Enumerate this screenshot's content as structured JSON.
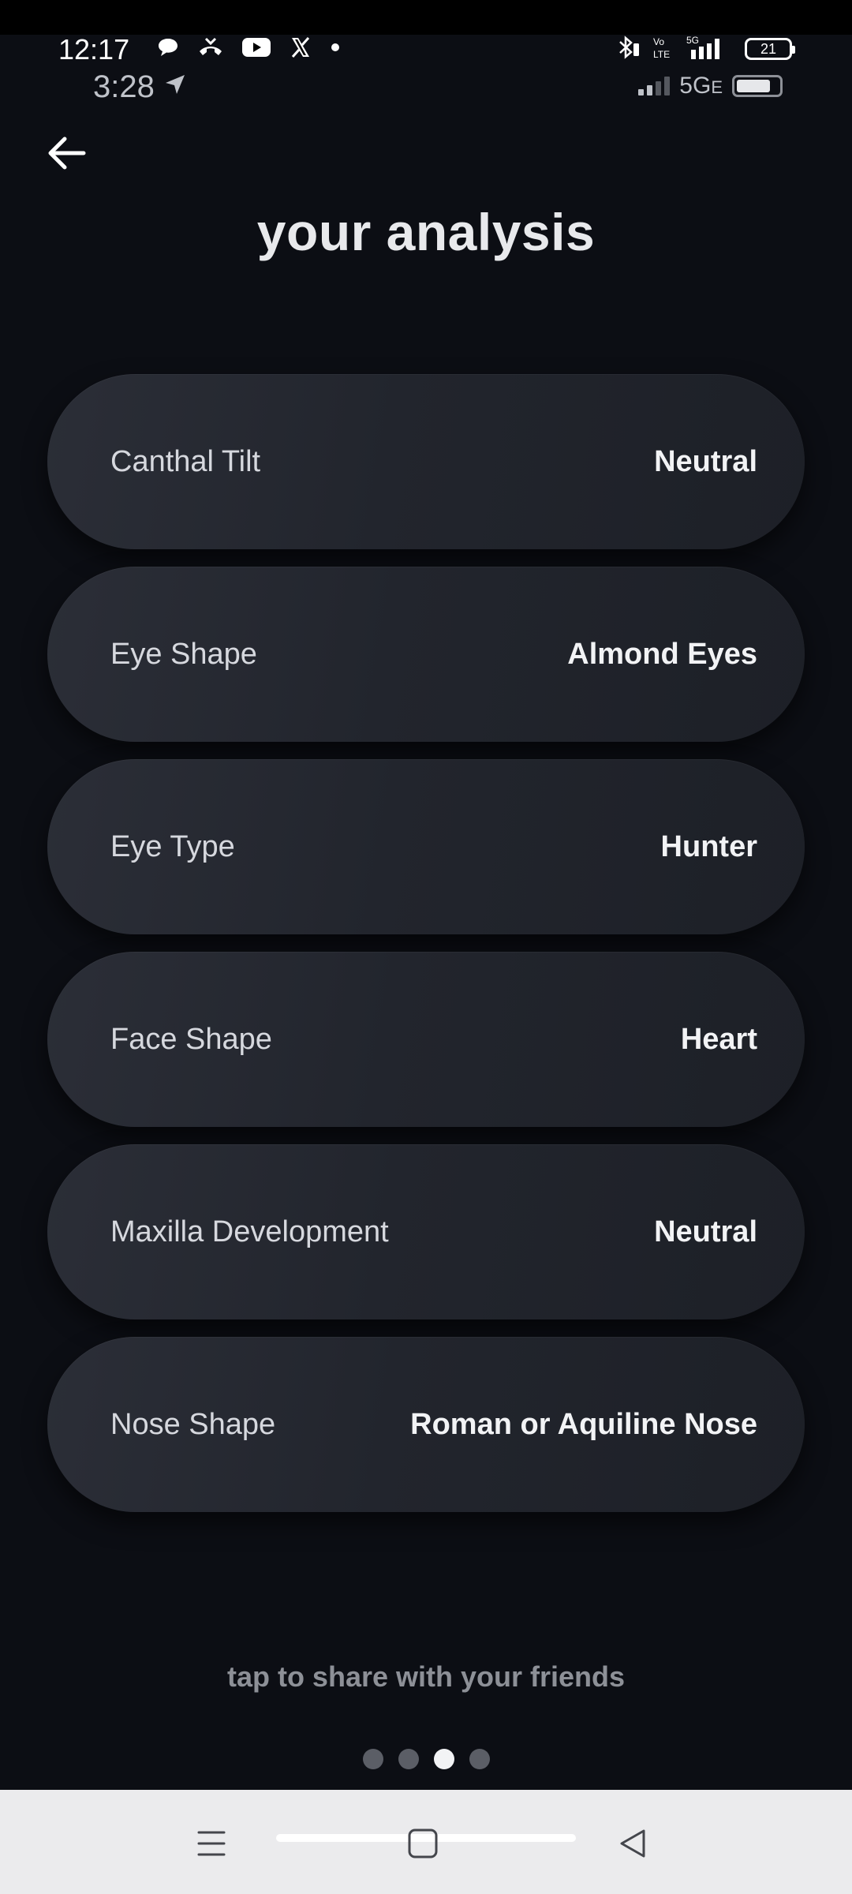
{
  "system_status": {
    "time": "12:17",
    "battery_level": "21",
    "left_icons": [
      "chat-bubble-icon",
      "missed-call-icon",
      "youtube-icon",
      "x-logo-icon",
      "dot-icon"
    ],
    "right_icons": [
      "bluetooth-icon",
      "volte-icon",
      "5g-signal-icon",
      "battery-icon"
    ]
  },
  "recorded_status": {
    "time": "3:28",
    "network": "5G",
    "network_suffix": "E"
  },
  "header": {
    "title": "your analysis"
  },
  "results": [
    {
      "label": "Canthal Tilt",
      "value": "Neutral"
    },
    {
      "label": "Eye Shape",
      "value": "Almond Eyes"
    },
    {
      "label": "Eye Type",
      "value": "Hunter"
    },
    {
      "label": "Face Shape",
      "value": "Heart"
    },
    {
      "label": "Maxilla Development",
      "value": "Neutral"
    },
    {
      "label": "Nose Shape",
      "value": "Roman or Aquiline Nose"
    }
  ],
  "footer": {
    "share_text": "tap to share with your friends",
    "page_count": 4,
    "active_page": 3
  },
  "colors": {
    "background": "#0c0e14",
    "card": "#23262e",
    "title": "#e8e9ec",
    "muted": "#8d9097",
    "nav_bar": "#ebebed"
  }
}
